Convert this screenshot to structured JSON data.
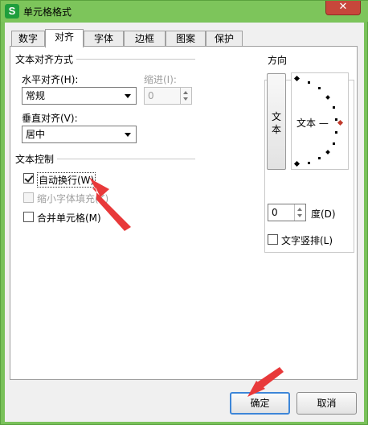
{
  "window": {
    "title": "单元格格式",
    "app_icon_letter": "S",
    "close_glyph": "✕"
  },
  "tabs": [
    {
      "label": "数字"
    },
    {
      "label": "对齐"
    },
    {
      "label": "字体"
    },
    {
      "label": "边框"
    },
    {
      "label": "图案"
    },
    {
      "label": "保护"
    }
  ],
  "alignment": {
    "group_title": "文本对齐方式",
    "horizontal_label": "水平对齐(H):",
    "horizontal_value": "常规",
    "indent_label": "缩进(I):",
    "indent_value": "0",
    "vertical_label": "垂直对齐(V):",
    "vertical_value": "居中"
  },
  "text_control": {
    "group_title": "文本控制",
    "wrap_label": "自动换行(W)",
    "wrap_checked": true,
    "shrink_label": "缩小字体填充(K)",
    "shrink_enabled": false,
    "merge_label": "合并单元格(M)",
    "merge_checked": false
  },
  "orientation": {
    "group_title": "方向",
    "vertical_text_char1": "文",
    "vertical_text_char2": "本",
    "dial_text": "文本 —",
    "degree_value": "0",
    "degree_label": "度(D)",
    "stacked_label": "文字竖排(L)",
    "stacked_checked": false
  },
  "buttons": {
    "ok_label": "确定",
    "cancel_label": "取消"
  },
  "colors": {
    "titlebar": "#7dc55b",
    "annotation_arrow": "#e8393a",
    "focus_border": "#3d86d8",
    "dial_marker": "#c0392b"
  }
}
